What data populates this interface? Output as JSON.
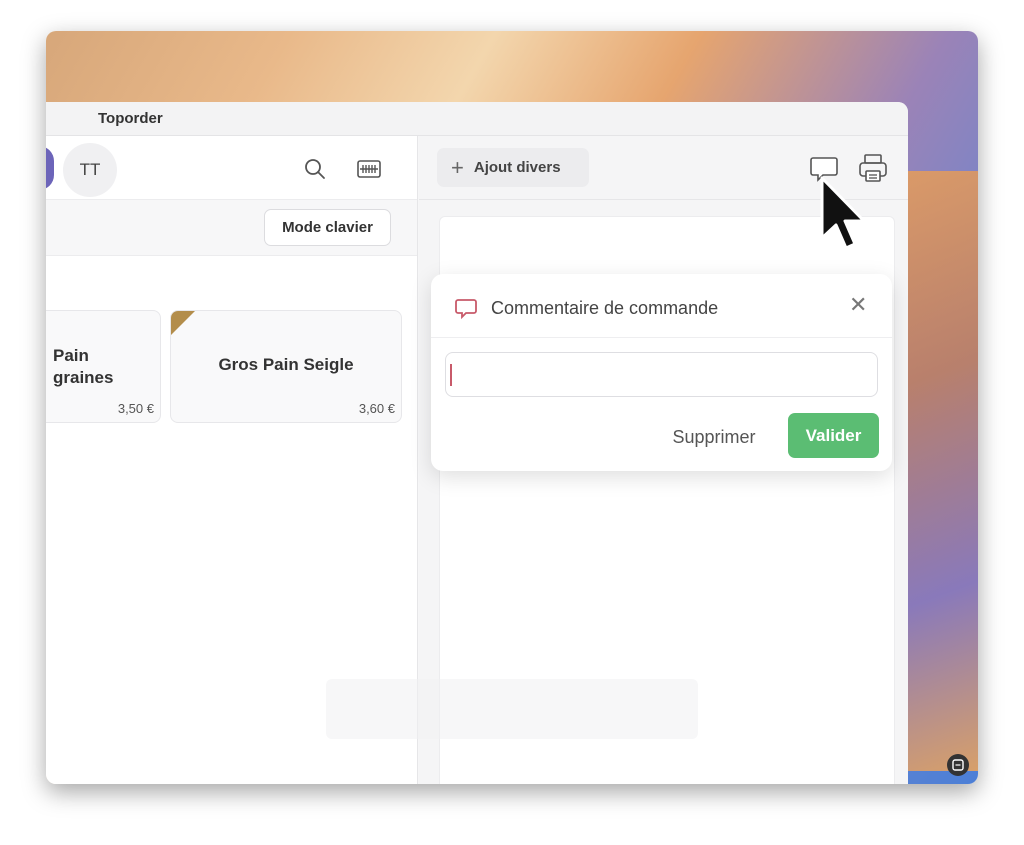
{
  "window": {
    "title": "Toporder"
  },
  "left_header": {
    "avatar_initials": "TT"
  },
  "toolbar": {
    "mode_label": "Mode clavier"
  },
  "products": [
    {
      "name": "Pain\ngraines",
      "price": "3,50 €"
    },
    {
      "name": "Gros Pain Seigle",
      "price": "3,60 €"
    }
  ],
  "right_header": {
    "add_misc_label": "Ajout divers"
  },
  "comment_popover": {
    "title": "Commentaire de commande",
    "input_value": "",
    "delete_label": "Supprimer",
    "validate_label": "Valider",
    "close_symbol": "✕"
  },
  "colors": {
    "accent_green": "#5bbd73",
    "accent_red": "#c85a6a",
    "tag_gold": "#b38d4b",
    "avatar_purple": "#6c64b9"
  },
  "icons": [
    "search-icon",
    "barcode-scan-icon",
    "comment-icon",
    "printer-icon",
    "plus-icon",
    "mouse-cursor-icon",
    "screen-capture-icon"
  ]
}
